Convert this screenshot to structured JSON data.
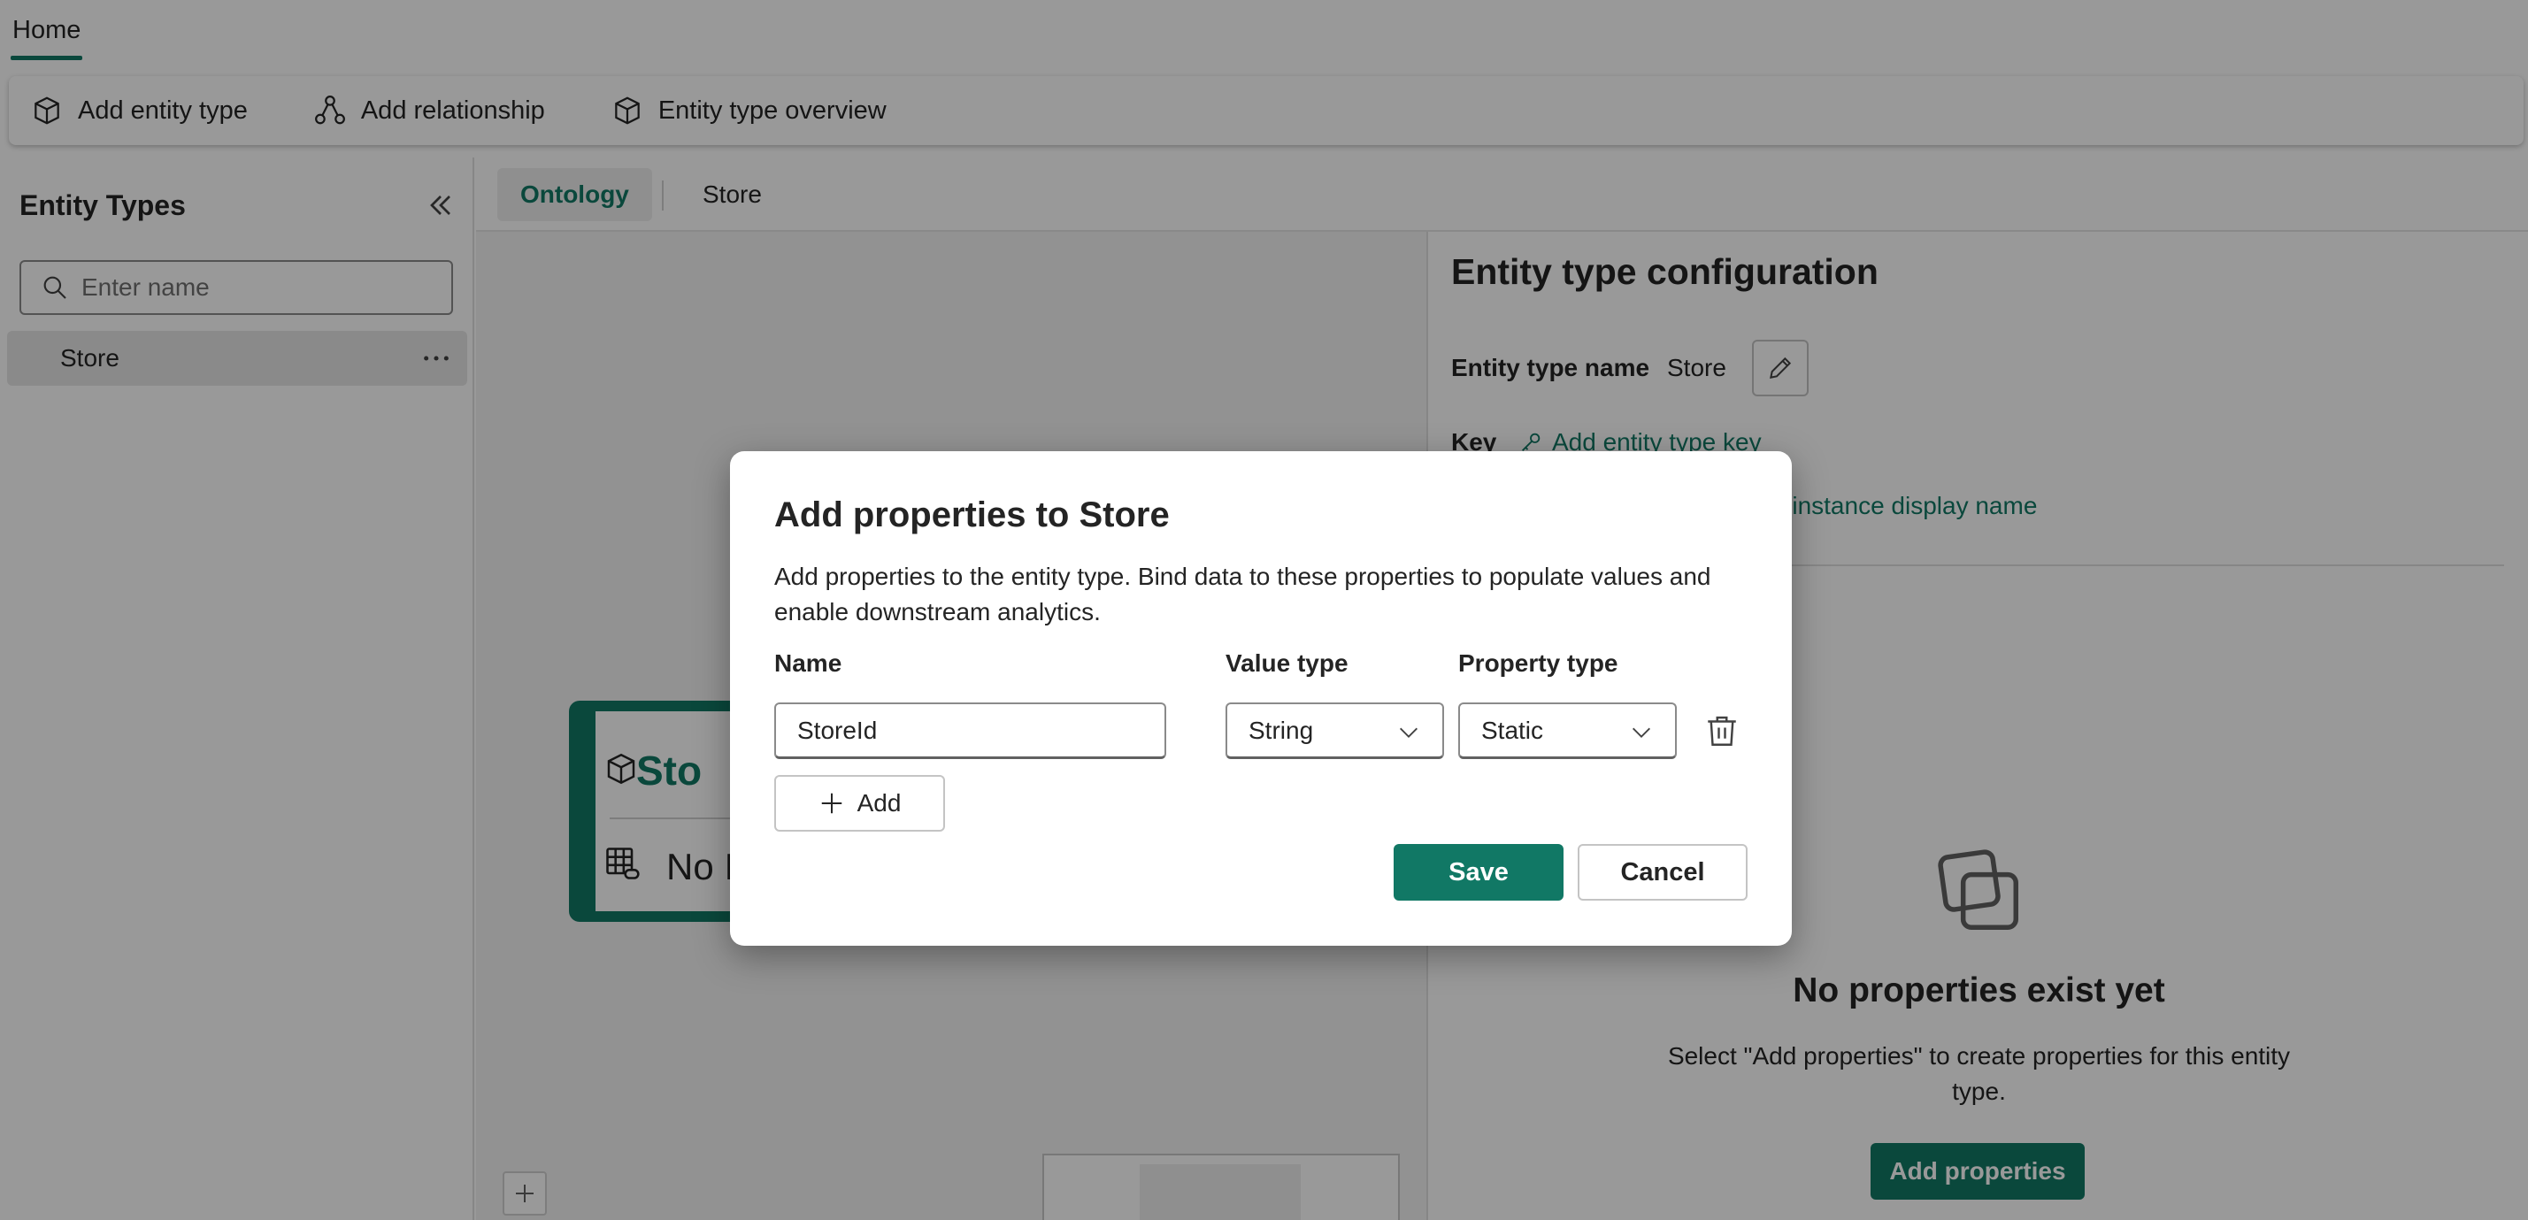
{
  "top_tabs": {
    "home": "Home"
  },
  "ribbon": {
    "add_entity_type": "Add entity type",
    "add_relationship": "Add relationship",
    "entity_type_overview": "Entity type overview"
  },
  "left_panel": {
    "title": "Entity Types",
    "search_placeholder": "Enter name",
    "items": [
      {
        "label": "Store"
      }
    ]
  },
  "canvas": {
    "tabs": [
      {
        "label": "Ontology",
        "active": true
      },
      {
        "label": "Store",
        "active": false
      }
    ],
    "node": {
      "name_partial": "Sto",
      "sub_partial": "No I"
    }
  },
  "config_panel": {
    "title": "Entity type configuration",
    "entity_type_name_label": "Entity type name",
    "entity_type_name_value": "Store",
    "key_label": "Key",
    "add_key_link": "Add entity type key",
    "add_display_name_link_partial": "d instance display name",
    "empty_title": "No properties exist yet",
    "empty_desc": "Select \"Add properties\" to create properties for this entity type.",
    "add_properties_button": "Add properties"
  },
  "dialog": {
    "title": "Add properties to Store",
    "description": "Add properties to the entity type. Bind data to these properties to populate values and enable downstream analytics.",
    "columns": {
      "name": "Name",
      "value_type": "Value type",
      "property_type": "Property type"
    },
    "rows": [
      {
        "name": "StoreId",
        "value_type": "String",
        "property_type": "Static"
      }
    ],
    "add_button": "Add",
    "save_button": "Save",
    "cancel_button": "Cancel"
  },
  "colors": {
    "accent": "#117865",
    "overlay": "rgba(0,0,0,0.40)"
  }
}
